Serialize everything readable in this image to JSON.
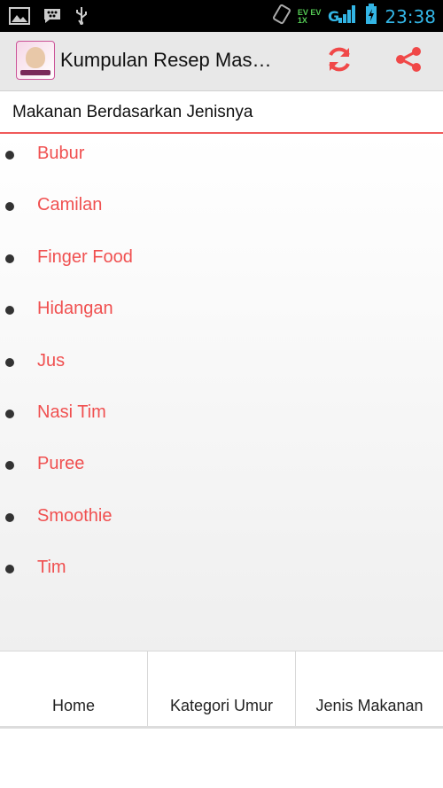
{
  "status_bar": {
    "time": "23:38",
    "network_top": "EV",
    "network_bottom": "1X",
    "network_mid": "EV",
    "signal_label": "G"
  },
  "action_bar": {
    "title": "Kumpulan Resep Mas…",
    "icon_name": "app-logo-baby-food",
    "accent": "#f04848"
  },
  "section": {
    "title": "Makanan Berdasarkan Jenisnya"
  },
  "list": {
    "items": [
      {
        "label": "Bubur"
      },
      {
        "label": "Camilan"
      },
      {
        "label": "Finger Food"
      },
      {
        "label": "Hidangan"
      },
      {
        "label": "Jus"
      },
      {
        "label": "Nasi Tim"
      },
      {
        "label": "Puree"
      },
      {
        "label": "Smoothie"
      },
      {
        "label": "Tim"
      }
    ]
  },
  "bottom_nav": {
    "tabs": [
      {
        "label": "Home"
      },
      {
        "label": "Kategori Umur"
      },
      {
        "label": "Jenis Makanan"
      }
    ]
  }
}
